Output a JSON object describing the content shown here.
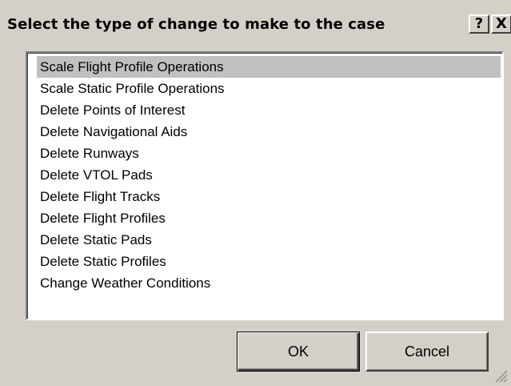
{
  "dialog": {
    "title": "Select the type of change to make to the case",
    "help_label": "?",
    "close_label": "X"
  },
  "list": {
    "selected_index": 0,
    "items": [
      "Scale Flight Profile Operations",
      "Scale Static Profile Operations",
      "Delete Points of Interest",
      "Delete Navigational Aids",
      "Delete Runways",
      "Delete VTOL Pads",
      "Delete Flight Tracks",
      "Delete Flight Profiles",
      "Delete Static Pads",
      "Delete Static Profiles",
      "Change Weather Conditions"
    ]
  },
  "buttons": {
    "ok_label": "OK",
    "cancel_label": "Cancel"
  },
  "colors": {
    "face": "#d4d0c8",
    "selection": "#c0c0c0"
  },
  "icons": [
    "help-icon",
    "close-icon",
    "resize-grip-icon"
  ]
}
